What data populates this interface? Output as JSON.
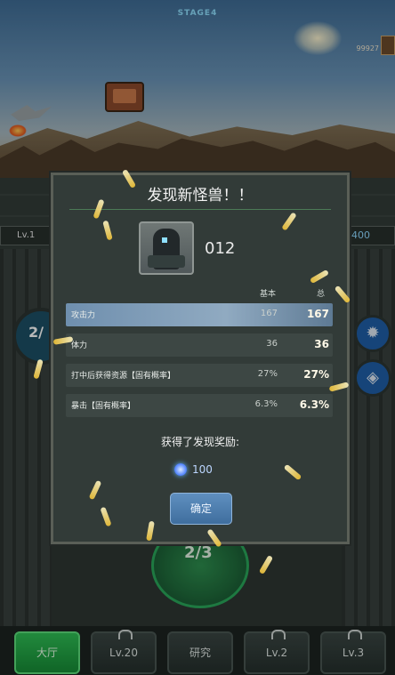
{
  "hud": {
    "stage_label": "STAGE4",
    "score": "99927",
    "left_level": "Lv.1",
    "right_value": "400",
    "left_dial": "2/",
    "center_dial": "2/3"
  },
  "dialog": {
    "title": "发现新怪兽！！",
    "monster_id": "012",
    "column_base": "基本",
    "column_total": "总",
    "stats": [
      {
        "label": "攻击力",
        "base": "167",
        "total": "167"
      },
      {
        "label": "体力",
        "base": "36",
        "total": "36"
      },
      {
        "label": "打中后获得资源【固有概率】",
        "base": "27%",
        "total": "27%"
      },
      {
        "label": "暴击【固有概率】",
        "base": "6.3%",
        "total": "6.3%"
      }
    ],
    "reward_title": "获得了发现奖励:",
    "reward_icon": "gem-icon",
    "reward_value": "100",
    "confirm_label": "确定"
  },
  "nav": {
    "items": [
      {
        "label": "大厅",
        "locked": false,
        "active": true
      },
      {
        "label": "Lv.20",
        "locked": true,
        "active": false
      },
      {
        "label": "研究",
        "locked": false,
        "active": false
      },
      {
        "label": "Lv.2",
        "locked": true,
        "active": false
      },
      {
        "label": "Lv.3",
        "locked": true,
        "active": false
      }
    ]
  },
  "colors": {
    "accent_green": "#2fbf55",
    "confirm_blue": "#4f7fb0",
    "dialog_bg": "#323b38",
    "highlight_row": "#7f9cb8"
  }
}
